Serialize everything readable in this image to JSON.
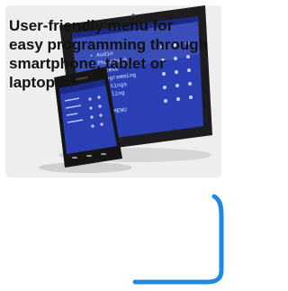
{
  "caption": {
    "text": "User-friendly menu for easy programming through smartphone, tablet or laptop"
  },
  "screen_menu": {
    "items": [
      "• Audio",
      "• Phonebook",
      "• Access",
      "• Programming",
      "• Settings",
      "• Filling"
    ],
    "footer": "Back  MENU"
  },
  "colors": {
    "accent": "#1e88e5",
    "screen": "#2a3fb4",
    "device_body": "#1d1d1f",
    "panel_bg": "#eeeeef"
  }
}
